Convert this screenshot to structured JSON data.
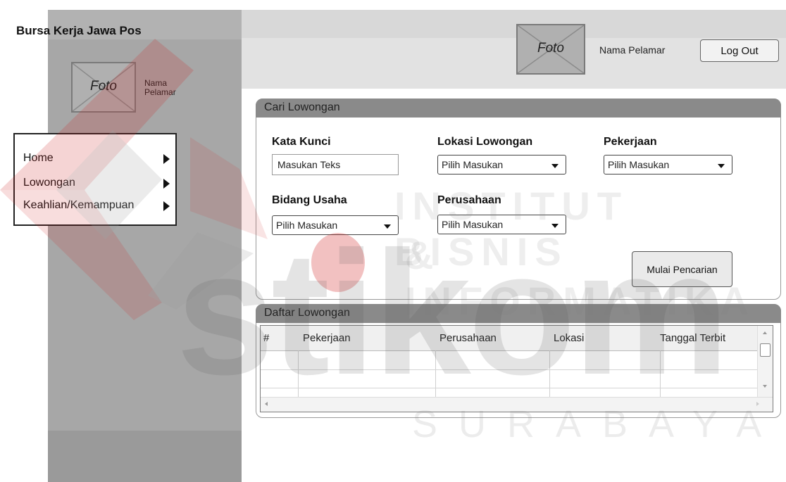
{
  "app": {
    "title": "Bursa Kerja Jawa Pos"
  },
  "sidebar": {
    "photo_label": "Foto",
    "user_name": "Nama Pelamar",
    "menu": [
      {
        "label": "Home"
      },
      {
        "label": "Lowongan"
      },
      {
        "label": "Keahlian/Kemampuan"
      }
    ]
  },
  "header": {
    "photo_label": "Foto",
    "user_name": "Nama Pelamar",
    "logout_label": "Log Out"
  },
  "search_panel": {
    "title": "Cari Lowongan",
    "keyword_label": "Kata Kunci",
    "keyword_placeholder": "Masukan Teks",
    "location_label": "Lokasi Lowongan",
    "location_value": "Pilih Masukan",
    "job_label": "Pekerjaan",
    "job_value": "Pilih Masukan",
    "industry_label": "Bidang Usaha",
    "industry_value": "Pilih Masukan",
    "company_label": "Perusahaan",
    "company_value": "Pilih Masukan",
    "search_button": "Mulai Pencarian"
  },
  "list_panel": {
    "title": "Daftar Lowongan",
    "columns": [
      "#",
      "Pekerjaan",
      "Perusahaan",
      "Lokasi",
      "Tanggal Terbit"
    ],
    "rows": []
  },
  "watermark": {
    "line1": "INSTITUT BISNIS",
    "line2": "& INFORMATIKA",
    "brand": "stikom",
    "city": "SURABAYA"
  }
}
